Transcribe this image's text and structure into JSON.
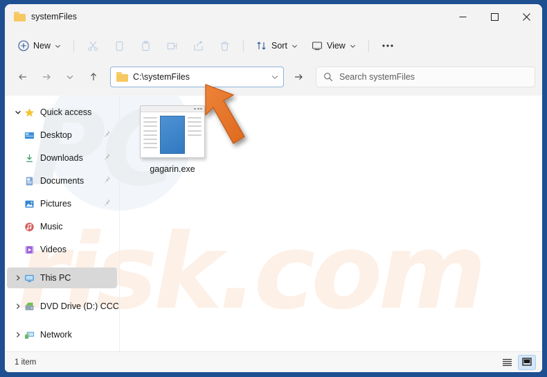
{
  "window": {
    "title": "systemFiles",
    "title_icon": "folder-icon",
    "border_color": "#1d4f91",
    "controls": [
      {
        "name": "minimize",
        "glyph": "minimize-icon"
      },
      {
        "name": "maximize",
        "glyph": "maximize-icon"
      },
      {
        "name": "close",
        "glyph": "close-icon"
      }
    ]
  },
  "toolbar": {
    "new_label": "New",
    "new_icon": "plus-circle-icon",
    "actions": [
      {
        "name": "cut",
        "icon": "scissors-icon"
      },
      {
        "name": "copy",
        "icon": "copy-icon"
      },
      {
        "name": "paste",
        "icon": "clipboard-icon"
      },
      {
        "name": "rename",
        "icon": "rename-icon"
      },
      {
        "name": "share",
        "icon": "share-icon"
      },
      {
        "name": "delete",
        "icon": "trash-icon"
      }
    ],
    "sort_label": "Sort",
    "sort_icon": "sort-arrows-icon",
    "view_label": "View",
    "view_icon": "monitor-icon",
    "more_label": "•••",
    "more_icon": "ellipsis-icon"
  },
  "address": {
    "back_icon": "arrow-left-icon",
    "forward_icon": "arrow-right-icon",
    "recent_icon": "chevron-down-icon",
    "up_icon": "arrow-up-icon",
    "path_icon": "folder-icon",
    "path": "C:\\systemFiles",
    "dropdown_icon": "chevron-down-icon",
    "go_icon": "arrow-right-icon"
  },
  "search": {
    "icon": "search-icon",
    "placeholder": "Search systemFiles"
  },
  "sidebar": {
    "items": [
      {
        "label": "Quick access",
        "icon": "star-icon",
        "twisty": "expanded",
        "pinned": false,
        "indent": false,
        "selected": false
      },
      {
        "label": "Desktop",
        "icon": "desktop-icon",
        "twisty": "none",
        "pinned": true,
        "indent": true,
        "selected": false
      },
      {
        "label": "Downloads",
        "icon": "download-icon",
        "twisty": "none",
        "pinned": true,
        "indent": true,
        "selected": false
      },
      {
        "label": "Documents",
        "icon": "documents-icon",
        "twisty": "none",
        "pinned": true,
        "indent": true,
        "selected": false
      },
      {
        "label": "Pictures",
        "icon": "pictures-icon",
        "twisty": "none",
        "pinned": true,
        "indent": true,
        "selected": false
      },
      {
        "label": "Music",
        "icon": "music-icon",
        "twisty": "none",
        "pinned": false,
        "indent": true,
        "selected": false
      },
      {
        "label": "Videos",
        "icon": "videos-icon",
        "twisty": "none",
        "pinned": false,
        "indent": true,
        "selected": false
      },
      {
        "label": "This PC",
        "icon": "this-pc-icon",
        "twisty": "collapsed",
        "pinned": false,
        "indent": false,
        "selected": true
      },
      {
        "label": "DVD Drive (D:) CCCC",
        "icon": "dvd-drive-icon",
        "twisty": "collapsed",
        "pinned": false,
        "indent": false,
        "selected": false
      },
      {
        "label": "Network",
        "icon": "network-icon",
        "twisty": "collapsed",
        "pinned": false,
        "indent": false,
        "selected": false
      }
    ]
  },
  "files": [
    {
      "name": "gagarin.exe",
      "icon": "application-window-icon"
    }
  ],
  "annotation": {
    "arrow_color": "#e3752a",
    "arrow_name": "orange-pointer-arrow"
  },
  "watermark": {
    "grey_text": "PC",
    "orange_text": "risk.com"
  },
  "statusbar": {
    "item_count": "1 item",
    "views": [
      {
        "name": "details-view",
        "icon": "list-lines-icon",
        "active": false
      },
      {
        "name": "large-icons-view",
        "icon": "large-icon-box-icon",
        "active": true
      }
    ]
  }
}
